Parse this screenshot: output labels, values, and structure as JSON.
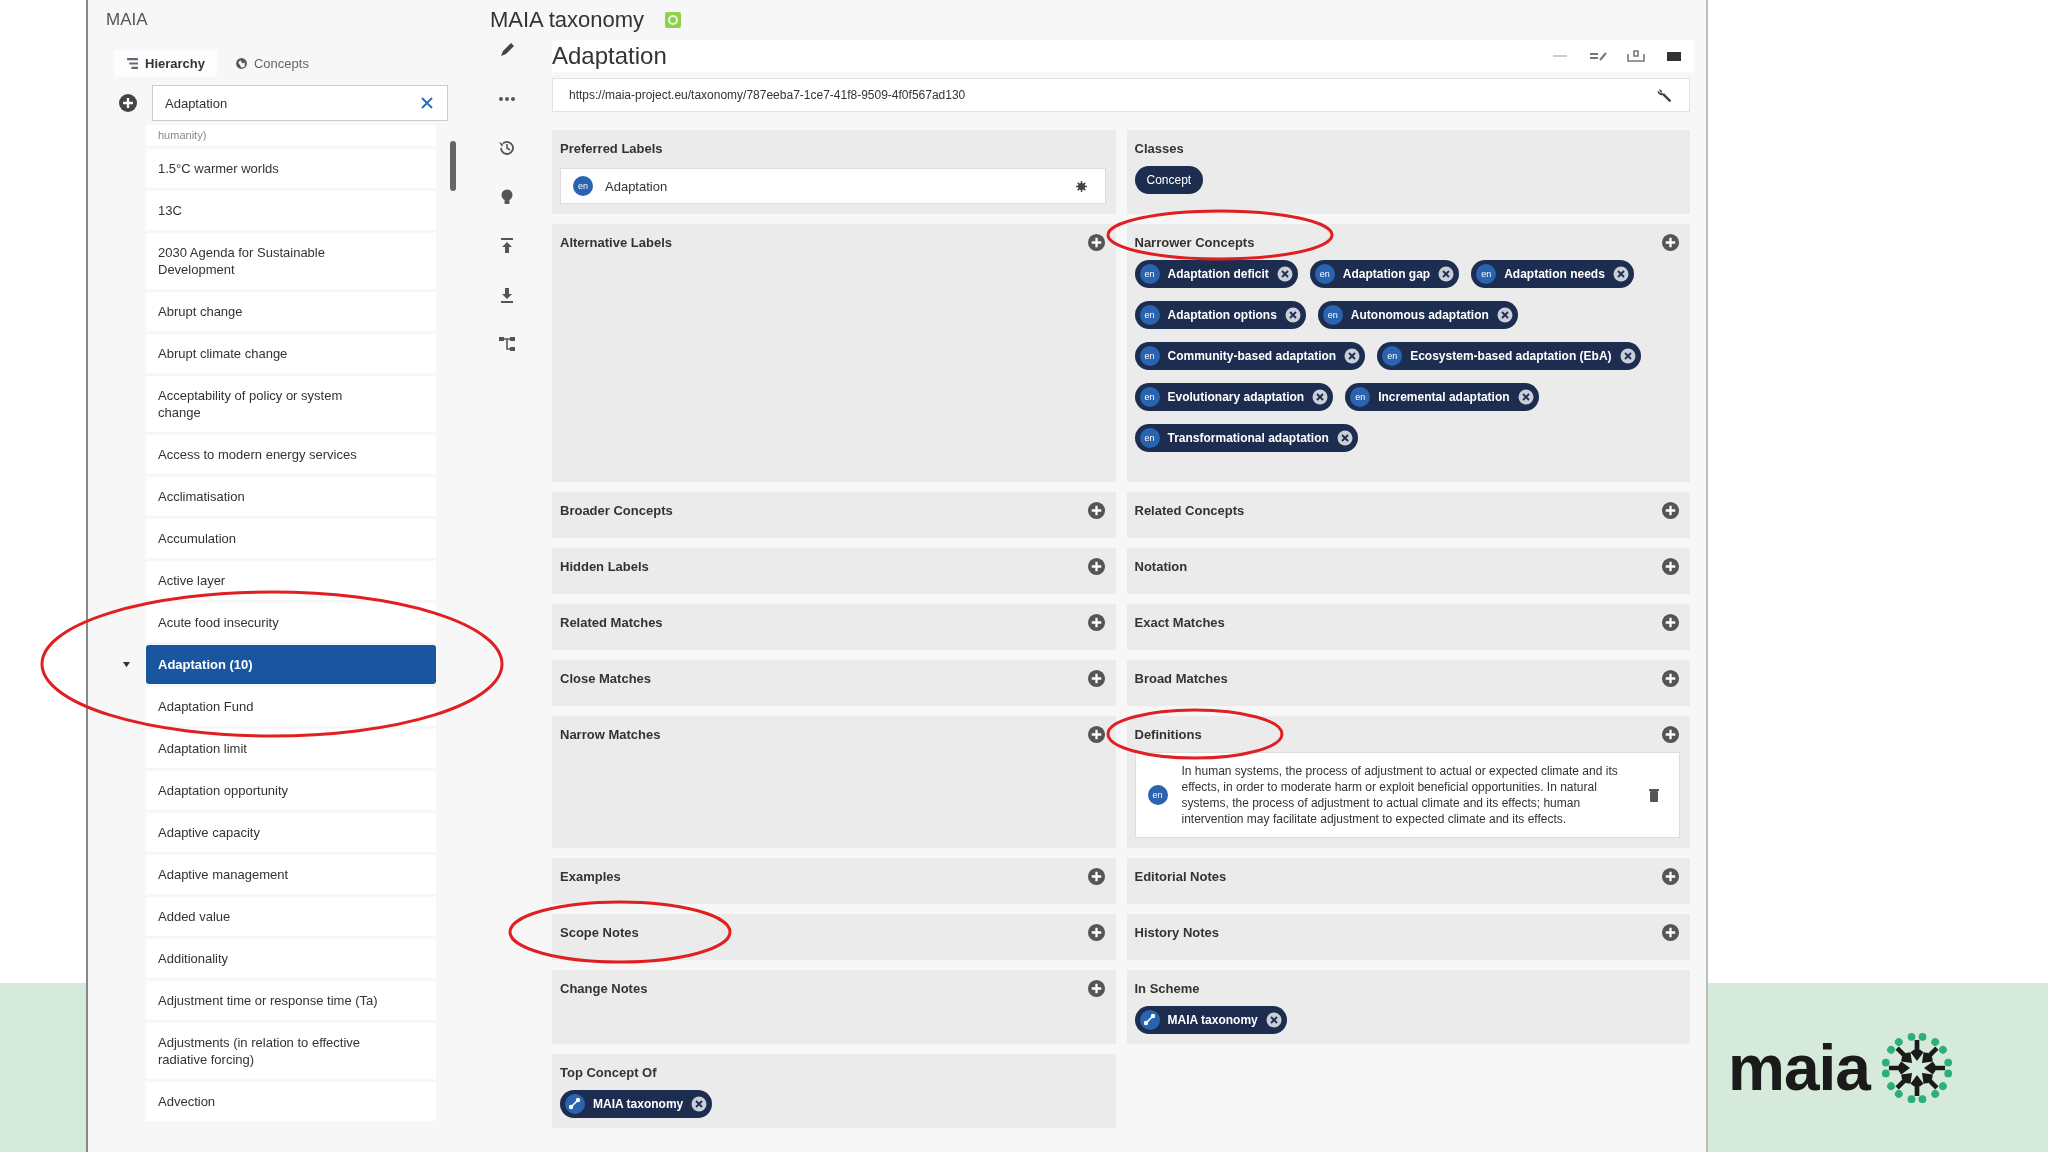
{
  "sidebar": {
    "title": "MAIA",
    "tabs": [
      {
        "label": "Hierarchy",
        "selected": true
      },
      {
        "label": "Concepts",
        "selected": false
      }
    ],
    "search": {
      "value": "Adaptation"
    },
    "items": [
      {
        "label": "humanity)",
        "selected": false,
        "expanded": false
      },
      {
        "label": "1.5°C warmer worlds",
        "selected": false,
        "expanded": false
      },
      {
        "label": "13C",
        "selected": false,
        "expanded": false
      },
      {
        "label": "2030 Agenda for Sustainable Development",
        "selected": false,
        "expanded": false
      },
      {
        "label": "Abrupt change",
        "selected": false,
        "expanded": false
      },
      {
        "label": "Abrupt climate change",
        "selected": false,
        "expanded": false
      },
      {
        "label": "Acceptability of policy or system change",
        "selected": false,
        "expanded": false
      },
      {
        "label": "Access to modern energy services",
        "selected": false,
        "expanded": false
      },
      {
        "label": "Acclimatisation",
        "selected": false,
        "expanded": false
      },
      {
        "label": "Accumulation",
        "selected": false,
        "expanded": false
      },
      {
        "label": "Active layer",
        "selected": false,
        "expanded": false
      },
      {
        "label": "Acute food insecurity",
        "selected": false,
        "expanded": false
      },
      {
        "label": "Adaptation (10)",
        "selected": true,
        "expanded": true
      },
      {
        "label": "Adaptation Fund",
        "selected": false,
        "expanded": false
      },
      {
        "label": "Adaptation limit",
        "selected": false,
        "expanded": false
      },
      {
        "label": "Adaptation opportunity",
        "selected": false,
        "expanded": false
      },
      {
        "label": "Adaptive capacity",
        "selected": false,
        "expanded": false
      },
      {
        "label": "Adaptive management",
        "selected": false,
        "expanded": false
      },
      {
        "label": "Added value",
        "selected": false,
        "expanded": false
      },
      {
        "label": "Additionality",
        "selected": false,
        "expanded": false
      },
      {
        "label": "Adjustment time or response time (Ta)",
        "selected": false,
        "expanded": false
      },
      {
        "label": "Adjustments (in relation to effective radiative forcing)",
        "selected": false,
        "expanded": false
      },
      {
        "label": "Advection",
        "selected": false,
        "expanded": false
      }
    ]
  },
  "main": {
    "app_title": "MAIA taxonomy",
    "concept": "Adaptation",
    "uri": "https://maia-project.eu/taxonomy/787eeba7-1ce7-41f8-9509-4f0f567ad130",
    "sections": [
      {
        "title": "Preferred Labels",
        "kind": "label",
        "add": false,
        "lang": "en",
        "text": "Adaptation"
      },
      {
        "title": "Classes",
        "kind": "classes",
        "add": false,
        "chips": [
          {
            "label": "Concept"
          }
        ]
      },
      {
        "title": "Alternative Labels",
        "kind": "empty",
        "add": true
      },
      {
        "title": "Narrower Concepts",
        "kind": "chips",
        "add": true,
        "chips": [
          {
            "lang": "en",
            "label": "Adaptation deficit"
          },
          {
            "lang": "en",
            "label": "Adaptation gap"
          },
          {
            "lang": "en",
            "label": "Adaptation needs"
          },
          {
            "lang": "en",
            "label": "Adaptation options"
          },
          {
            "lang": "en",
            "label": "Autonomous adaptation"
          },
          {
            "lang": "en",
            "label": "Community-based adaptation"
          },
          {
            "lang": "en",
            "label": "Ecosystem-based adaptation (EbA)"
          },
          {
            "lang": "en",
            "label": "Evolutionary adaptation"
          },
          {
            "lang": "en",
            "label": "Incremental adaptation"
          },
          {
            "lang": "en",
            "label": "Transformational adaptation"
          }
        ]
      },
      {
        "title": "Broader Concepts",
        "kind": "empty",
        "add": true
      },
      {
        "title": "Related Concepts",
        "kind": "empty",
        "add": true
      },
      {
        "title": "Hidden Labels",
        "kind": "empty",
        "add": true
      },
      {
        "title": "Notation",
        "kind": "empty",
        "add": true
      },
      {
        "title": "Related Matches",
        "kind": "empty",
        "add": true
      },
      {
        "title": "Exact Matches",
        "kind": "empty",
        "add": true
      },
      {
        "title": "Close Matches",
        "kind": "empty",
        "add": true
      },
      {
        "title": "Broad Matches",
        "kind": "empty",
        "add": true
      },
      {
        "title": "Narrow Matches",
        "kind": "empty",
        "add": true
      },
      {
        "title": "Definitions",
        "kind": "definition",
        "add": true,
        "lang": "en",
        "text": "In human systems, the process of adjustment to actual or expected climate and its effects, in order to moderate harm or exploit beneficial opportunities. In natural systems, the process of adjustment to actual climate and its effects; human intervention may facilitate adjustment to expected climate and its effects."
      },
      {
        "title": "Examples",
        "kind": "empty",
        "add": true
      },
      {
        "title": "Editorial Notes",
        "kind": "empty",
        "add": true
      },
      {
        "title": "Scope Notes",
        "kind": "empty",
        "add": true
      },
      {
        "title": "History Notes",
        "kind": "empty",
        "add": true
      },
      {
        "title": "Change Notes",
        "kind": "empty",
        "add": true
      },
      {
        "title": "In Scheme",
        "kind": "scheme",
        "add": false,
        "chips": [
          {
            "label": "MAIA taxonomy"
          }
        ]
      },
      {
        "title": "Top Concept Of",
        "kind": "scheme",
        "add": false,
        "chips": [
          {
            "label": "MAIA taxonomy"
          }
        ]
      }
    ]
  },
  "logo": {
    "text": "maia"
  }
}
